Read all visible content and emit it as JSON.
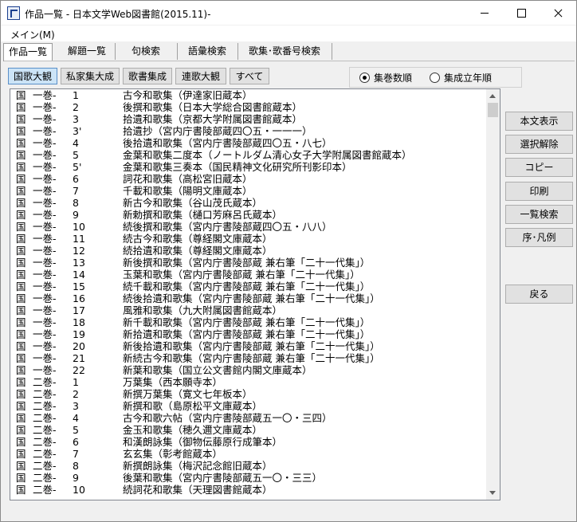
{
  "window": {
    "title": "作品一覧 - 日本文学Web図書館(2015.11)-"
  },
  "menu": {
    "main_label": "メイン(M)"
  },
  "tabs": [
    {
      "label": "作品一覧",
      "active": true
    },
    {
      "label": "解題一覧",
      "active": false
    },
    {
      "label": "句検索",
      "active": false
    },
    {
      "label": "語彙検索",
      "active": false
    },
    {
      "label": "歌集･歌番号検索",
      "active": false
    }
  ],
  "filters": [
    {
      "label": "国歌大観",
      "pressed": true
    },
    {
      "label": "私家集大成",
      "pressed": false
    },
    {
      "label": "歌書集成",
      "pressed": false
    },
    {
      "label": "連歌大観",
      "pressed": false
    },
    {
      "label": "すべて",
      "pressed": false
    }
  ],
  "sort": {
    "option1": "集巻数順",
    "option2": "集成立年順",
    "selected": "集巻数順"
  },
  "list": [
    {
      "src": "国",
      "vol": "一巻-",
      "no": "1",
      "title": "古今和歌集（伊達家旧蔵本）"
    },
    {
      "src": "国",
      "vol": "一巻-",
      "no": "2",
      "title": "後撰和歌集（日本大学総合図書館蔵本）"
    },
    {
      "src": "国",
      "vol": "一巻-",
      "no": "3",
      "title": "拾遺和歌集（京都大学附属図書館蔵本）"
    },
    {
      "src": "国",
      "vol": "一巻-",
      "no": "3'",
      "title": "拾遺抄（宮内庁書陵部蔵四〇五・一一一）"
    },
    {
      "src": "国",
      "vol": "一巻-",
      "no": "4",
      "title": "後拾遺和歌集（宮内庁書陵部蔵四〇五・八七）"
    },
    {
      "src": "国",
      "vol": "一巻-",
      "no": "5",
      "title": "金葉和歌集二度本（ノートルダム清心女子大学附属図書館蔵本）"
    },
    {
      "src": "国",
      "vol": "一巻-",
      "no": "5'",
      "title": "金葉和歌集三奏本（国民精神文化研究所刊影印本）"
    },
    {
      "src": "国",
      "vol": "一巻-",
      "no": "6",
      "title": "詞花和歌集（高松宮旧蔵本）"
    },
    {
      "src": "国",
      "vol": "一巻-",
      "no": "7",
      "title": "千載和歌集（陽明文庫蔵本）"
    },
    {
      "src": "国",
      "vol": "一巻-",
      "no": "8",
      "title": "新古今和歌集（谷山茂氏蔵本）"
    },
    {
      "src": "国",
      "vol": "一巻-",
      "no": "9",
      "title": "新勅撰和歌集（樋口芳麻呂氏蔵本）"
    },
    {
      "src": "国",
      "vol": "一巻-",
      "no": "10",
      "title": "続後撰和歌集（宮内庁書陵部蔵四〇五・八八）"
    },
    {
      "src": "国",
      "vol": "一巻-",
      "no": "11",
      "title": "続古今和歌集（尊経閣文庫蔵本）"
    },
    {
      "src": "国",
      "vol": "一巻-",
      "no": "12",
      "title": "続拾遺和歌集（尊経閣文庫蔵本）"
    },
    {
      "src": "国",
      "vol": "一巻-",
      "no": "13",
      "title": "新後撰和歌集（宮内庁書陵部蔵 兼右筆「二十一代集」）"
    },
    {
      "src": "国",
      "vol": "一巻-",
      "no": "14",
      "title": "玉葉和歌集（宮内庁書陵部蔵 兼右筆「二十一代集」）"
    },
    {
      "src": "国",
      "vol": "一巻-",
      "no": "15",
      "title": "続千載和歌集（宮内庁書陵部蔵 兼右筆「二十一代集」）"
    },
    {
      "src": "国",
      "vol": "一巻-",
      "no": "16",
      "title": "続後拾遺和歌集（宮内庁書陵部蔵 兼右筆「二十一代集」）"
    },
    {
      "src": "国",
      "vol": "一巻-",
      "no": "17",
      "title": "風雅和歌集（九大附属図書館蔵本）"
    },
    {
      "src": "国",
      "vol": "一巻-",
      "no": "18",
      "title": "新千載和歌集（宮内庁書陵部蔵 兼右筆「二十一代集」）"
    },
    {
      "src": "国",
      "vol": "一巻-",
      "no": "19",
      "title": "新拾遺和歌集（宮内庁書陵部蔵 兼右筆「二十一代集」）"
    },
    {
      "src": "国",
      "vol": "一巻-",
      "no": "20",
      "title": "新後拾遺和歌集（宮内庁書陵部蔵 兼右筆「二十一代集」）"
    },
    {
      "src": "国",
      "vol": "一巻-",
      "no": "21",
      "title": "新続古今和歌集（宮内庁書陵部蔵 兼右筆「二十一代集」）"
    },
    {
      "src": "国",
      "vol": "一巻-",
      "no": "22",
      "title": "新葉和歌集（国立公文書館内閣文庫蔵本）"
    },
    {
      "src": "国",
      "vol": "二巻-",
      "no": "1",
      "title": "万葉集（西本願寺本）"
    },
    {
      "src": "国",
      "vol": "二巻-",
      "no": "2",
      "title": "新撰万葉集（寛文七年板本）"
    },
    {
      "src": "国",
      "vol": "二巻-",
      "no": "3",
      "title": "新撰和歌（島原松平文庫蔵本）"
    },
    {
      "src": "国",
      "vol": "二巻-",
      "no": "4",
      "title": "古今和歌六帖（宮内庁書陵部蔵五一〇・三四）"
    },
    {
      "src": "国",
      "vol": "二巻-",
      "no": "5",
      "title": "金玉和歌集（穂久邇文庫蔵本）"
    },
    {
      "src": "国",
      "vol": "二巻-",
      "no": "6",
      "title": "和漢朗詠集（御物伝藤原行成筆本）"
    },
    {
      "src": "国",
      "vol": "二巻-",
      "no": "7",
      "title": "玄玄集（彰考館蔵本）"
    },
    {
      "src": "国",
      "vol": "二巻-",
      "no": "8",
      "title": "新撰朗詠集（梅沢記念館旧蔵本）"
    },
    {
      "src": "国",
      "vol": "二巻-",
      "no": "9",
      "title": "後葉和歌集（宮内庁書陵部蔵五一〇・三三）"
    },
    {
      "src": "国",
      "vol": "二巻-",
      "no": "10",
      "title": "続詞花和歌集（天理図書館蔵本）"
    }
  ],
  "side_buttons": {
    "view_text": "本文表示",
    "deselect": "選択解除",
    "copy": "コピー",
    "print": "印刷",
    "list_search": "一覧検索",
    "preface": "序･凡例",
    "back": "戻る"
  }
}
